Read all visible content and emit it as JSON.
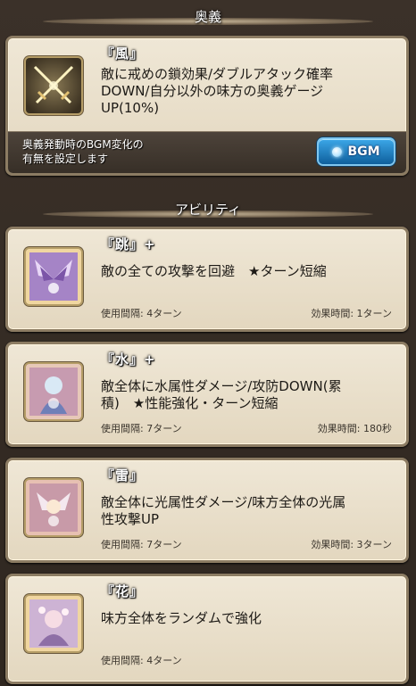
{
  "ougi_section": {
    "title": "奥義",
    "skill": {
      "name": "『風』",
      "icon": "crossed-swords-icon",
      "desc_line1": "敵に戒めの鎖効果/ダブルアタック確率",
      "desc_line2": "DOWN/自分以外の味方の奥義ゲージ",
      "desc_line3": "UP(10%)",
      "bgm_note_line1": "奥義発動時のBGM変化の",
      "bgm_note_line2": "有無を設定します",
      "bgm_button_label": "BGM"
    }
  },
  "ability_section": {
    "title": "アビリティ",
    "items": [
      {
        "name": "『跳』+",
        "icon": "purple-wings-icon",
        "desc_line1": "敵の全ての攻撃を回避　★ターン短縮",
        "desc_line2": "",
        "interval": "使用間隔: 4ターン",
        "duration": "効果時間: 1ターン"
      },
      {
        "name": "『水』+",
        "icon": "water-character-icon",
        "desc_line1": "敵全体に水属性ダメージ/攻防DOWN(累",
        "desc_line2": "積)　★性能強化・ターン短縮",
        "interval": "使用間隔: 7ターン",
        "duration": "効果時間: 180秒"
      },
      {
        "name": "『雷』",
        "icon": "thunder-character-icon",
        "desc_line1": "敵全体に光属性ダメージ/味方全体の光属",
        "desc_line2": "性攻撃UP",
        "interval": "使用間隔: 7ターン",
        "duration": "効果時間: 3ターン"
      },
      {
        "name": "『花』",
        "icon": "flower-character-icon",
        "desc_line1": "味方全体をランダムで強化",
        "desc_line2": "",
        "interval": "使用間隔: 4ターン",
        "duration": ""
      }
    ]
  }
}
